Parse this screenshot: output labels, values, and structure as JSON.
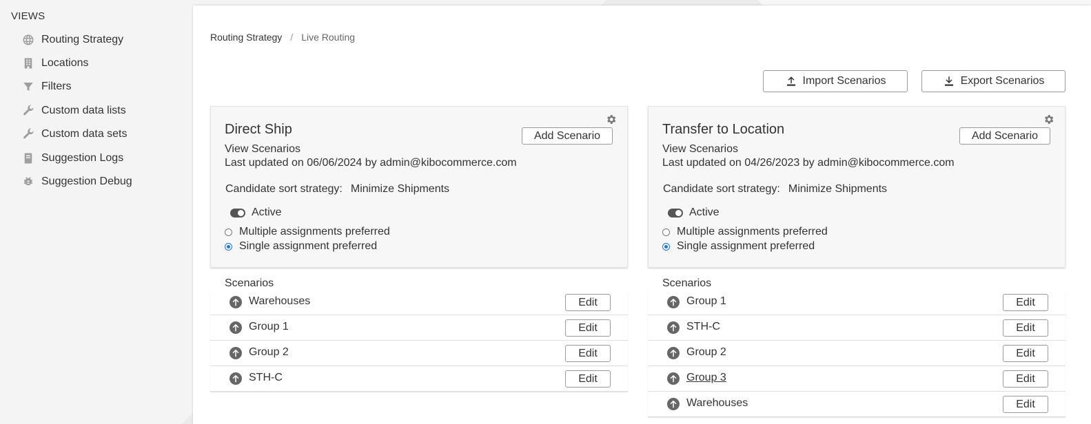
{
  "sidebar": {
    "title": "VIEWS",
    "items": [
      {
        "label": "Routing Strategy",
        "icon": "globe-icon"
      },
      {
        "label": "Locations",
        "icon": "building-icon"
      },
      {
        "label": "Filters",
        "icon": "funnel-icon"
      },
      {
        "label": "Custom data lists",
        "icon": "wrench-icon"
      },
      {
        "label": "Custom data sets",
        "icon": "wrench-icon"
      },
      {
        "label": "Suggestion Logs",
        "icon": "book-icon"
      },
      {
        "label": "Suggestion Debug",
        "icon": "bug-icon"
      }
    ]
  },
  "breadcrumb": {
    "root": "Routing Strategy",
    "separator": "/",
    "current": "Live Routing"
  },
  "toolbar": {
    "import_label": "Import Scenarios",
    "export_label": "Export Scenarios"
  },
  "cards": [
    {
      "title": "Direct Ship",
      "add_label": "Add Scenario",
      "view_label": "View Scenarios",
      "updated": "Last updated on 06/06/2024 by admin@kibocommerce.com",
      "sort_label": "Candidate sort strategy:",
      "sort_value": "Minimize Shipments",
      "active_label": "Active",
      "radio_multiple": "Multiple assignments preferred",
      "radio_single": "Single assignment preferred",
      "scenarios_label": "Scenarios",
      "scenarios": [
        {
          "name": "Warehouses",
          "edit": "Edit"
        },
        {
          "name": "Group 1",
          "edit": "Edit"
        },
        {
          "name": "Group 2",
          "edit": "Edit"
        },
        {
          "name": "STH-C",
          "edit": "Edit"
        }
      ]
    },
    {
      "title": "Transfer to Location",
      "add_label": "Add Scenario",
      "view_label": "View Scenarios",
      "updated": "Last updated on 04/26/2023 by admin@kibocommerce.com",
      "sort_label": "Candidate sort strategy:",
      "sort_value": "Minimize Shipments",
      "active_label": "Active",
      "radio_multiple": "Multiple assignments preferred",
      "radio_single": "Single assignment preferred",
      "scenarios_label": "Scenarios",
      "scenarios": [
        {
          "name": "Group 1",
          "edit": "Edit"
        },
        {
          "name": "STH-C",
          "edit": "Edit"
        },
        {
          "name": "Group 2",
          "edit": "Edit"
        },
        {
          "name": "Group 3",
          "edit": "Edit",
          "underlined": true
        },
        {
          "name": "Warehouses",
          "edit": "Edit"
        }
      ]
    }
  ],
  "colors": {
    "radio_selected": "#1a73e8",
    "toggle_on": "#555555"
  }
}
